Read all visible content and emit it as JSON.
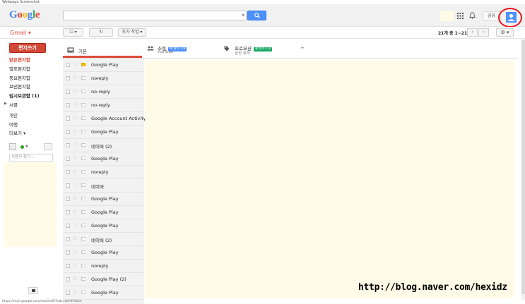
{
  "caption": "Webpage Screenshot",
  "header": {
    "logo_letters": [
      {
        "ch": "G",
        "color": "#4285f4"
      },
      {
        "ch": "o",
        "color": "#ea4335"
      },
      {
        "ch": "o",
        "color": "#fbbc05"
      },
      {
        "ch": "g",
        "color": "#4285f4"
      },
      {
        "ch": "l",
        "color": "#34a853"
      },
      {
        "ch": "e",
        "color": "#ea4335"
      }
    ],
    "share_label": "공유",
    "search_icon": "search-icon",
    "apps_icon": "grid-icon",
    "notification_icon": "bell-icon",
    "avatar_icon": "person-icon"
  },
  "toolbar": {
    "gmail_label": "Gmail ▾",
    "select_label": "☐ ▾",
    "refresh_label": "↻",
    "more_label": "추가 작업 ▾",
    "page_info": "21개 중 1~21",
    "prev_label": "‹",
    "next_label": "›",
    "settings_label": "⚙ ▾"
  },
  "sidebar": {
    "compose_label": "편지쓰기",
    "items": [
      {
        "label": "받은편지함",
        "state": "active"
      },
      {
        "label": "별표편지함",
        "state": ""
      },
      {
        "label": "중요편지함",
        "state": ""
      },
      {
        "label": "보낸편지함",
        "state": ""
      },
      {
        "label": "임시보관함 (1)",
        "state": "bold"
      },
      {
        "label": "서클",
        "state": ""
      },
      {
        "label": "개인",
        "state": ""
      },
      {
        "label": "여행",
        "state": ""
      },
      {
        "label": "더보기 ▾",
        "state": ""
      }
    ],
    "people_search_placeholder": "사용자 찾기..."
  },
  "tabs": [
    {
      "label": "기본",
      "sub": "",
      "badge": ""
    },
    {
      "label": "소셜",
      "sub": "YouTube",
      "badge": "새 항목 1개"
    },
    {
      "label": "프로모션",
      "sub": "삼성 뮤직",
      "badge": "새 항목 1개"
    }
  ],
  "tab_add_label": "+",
  "emails": [
    {
      "sender": "Google Play",
      "important": true
    },
    {
      "sender": "noreply",
      "important": false
    },
    {
      "sender": "no-reply",
      "important": false
    },
    {
      "sender": "no-reply",
      "important": false
    },
    {
      "sender": "Google Account Activity",
      "important": false
    },
    {
      "sender": "Google Play",
      "important": false
    },
    {
      "sender": "네이버 (2)",
      "important": false
    },
    {
      "sender": "Google Play",
      "important": false
    },
    {
      "sender": "noreply",
      "important": false
    },
    {
      "sender": "네이버",
      "important": false
    },
    {
      "sender": "Google Play",
      "important": false
    },
    {
      "sender": "Google Play",
      "important": false
    },
    {
      "sender": "Google Play",
      "important": false
    },
    {
      "sender": "네이버 (2)",
      "important": false
    },
    {
      "sender": "Google Play",
      "important": false
    },
    {
      "sender": "noreply",
      "important": false
    },
    {
      "sender": "Google Play (2)",
      "important": false
    },
    {
      "sender": "Google Play",
      "important": false
    }
  ],
  "watermark": "http://blog.naver.com/hexidz",
  "status_url": "https://mail.google.com/mail/u/0/?tab=wm#inbox",
  "colors": {
    "accent_red": "#dd4b39",
    "search_blue": "#4d90fe",
    "highlight_circle": "#e8141c",
    "preview_yellow": "#fffbe6"
  }
}
